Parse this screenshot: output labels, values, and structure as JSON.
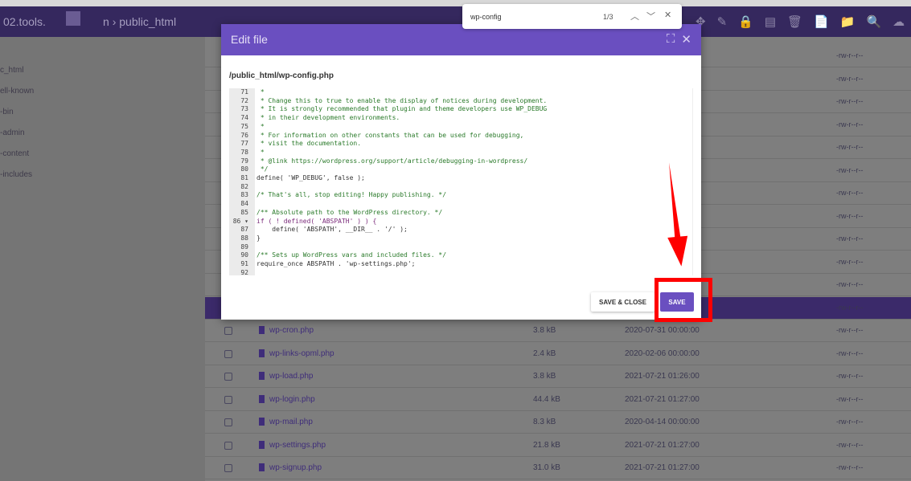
{
  "topbar": {
    "host": "02.tools.",
    "crumb_mid": "n",
    "separator": "›",
    "crumb": "public_html"
  },
  "toolbar_icons": [
    "move-icon",
    "edit-icon",
    "lock-icon",
    "archive-icon",
    "trash-icon",
    "new-file-icon",
    "new-folder-icon",
    "search-icon",
    "upload-icon",
    "refresh-icon"
  ],
  "sidebar": [
    "c_html",
    "ell-known",
    "-bin",
    "-admin",
    "-content",
    "-includes"
  ],
  "permissions": "-rw-r--r--",
  "files": [
    {
      "name": "wp-cron.php",
      "size": "3.8 kB",
      "date": "2020-07-31 00:00:00"
    },
    {
      "name": "wp-links-opml.php",
      "size": "2.4 kB",
      "date": "2020-02-06 00:00:00"
    },
    {
      "name": "wp-load.php",
      "size": "3.8 kB",
      "date": "2021-07-21 01:26:00"
    },
    {
      "name": "wp-login.php",
      "size": "44.4 kB",
      "date": "2021-07-21 01:27:00"
    },
    {
      "name": "wp-mail.php",
      "size": "8.3 kB",
      "date": "2020-04-14 00:00:00"
    },
    {
      "name": "wp-settings.php",
      "size": "21.8 kB",
      "date": "2021-07-21 01:27:00"
    },
    {
      "name": "wp-signup.php",
      "size": "31.0 kB",
      "date": "2021-07-21 01:27:00"
    }
  ],
  "find": {
    "query": "wp-config",
    "count": "1/3"
  },
  "modal": {
    "title": "Edit file",
    "path": "/public_html/wp-config.php",
    "save_close": "SAVE & CLOSE",
    "save": "SAVE",
    "lines": [
      {
        "n": "71",
        "t": " *",
        "c": "c"
      },
      {
        "n": "72",
        "t": " * Change this to true to enable the display of notices during development.",
        "c": "c"
      },
      {
        "n": "73",
        "t": " * It is strongly recommended that plugin and theme developers use WP_DEBUG",
        "c": "c"
      },
      {
        "n": "74",
        "t": " * in their development environments.",
        "c": "c"
      },
      {
        "n": "75",
        "t": " *",
        "c": "c"
      },
      {
        "n": "76",
        "t": " * For information on other constants that can be used for debugging,",
        "c": "c"
      },
      {
        "n": "77",
        "t": " * visit the documentation.",
        "c": "c"
      },
      {
        "n": "78",
        "t": " *",
        "c": "c"
      },
      {
        "n": "79",
        "t": " * @link https://wordpress.org/support/article/debugging-in-wordpress/",
        "c": "c"
      },
      {
        "n": "80",
        "t": " */",
        "c": "c"
      },
      {
        "n": "81",
        "t": "define( 'WP_DEBUG', false );",
        "c": ""
      },
      {
        "n": "82",
        "t": "",
        "c": ""
      },
      {
        "n": "83",
        "t": "/* That's all, stop editing! Happy publishing. */",
        "c": "c"
      },
      {
        "n": "84",
        "t": "",
        "c": ""
      },
      {
        "n": "85",
        "t": "/** Absolute path to the WordPress directory. */",
        "c": "c"
      },
      {
        "n": "86 ▾",
        "t": "if ( ! defined( 'ABSPATH' ) ) {",
        "c": "k"
      },
      {
        "n": "87",
        "t": "    define( 'ABSPATH', __DIR__ . '/' );",
        "c": ""
      },
      {
        "n": "88",
        "t": "}",
        "c": ""
      },
      {
        "n": "89",
        "t": "",
        "c": ""
      },
      {
        "n": "90",
        "t": "/** Sets up WordPress vars and included files. */",
        "c": "c"
      },
      {
        "n": "91",
        "t": "require_once ABSPATH . 'wp-settings.php';",
        "c": ""
      },
      {
        "n": "92",
        "t": "",
        "c": ""
      }
    ]
  }
}
